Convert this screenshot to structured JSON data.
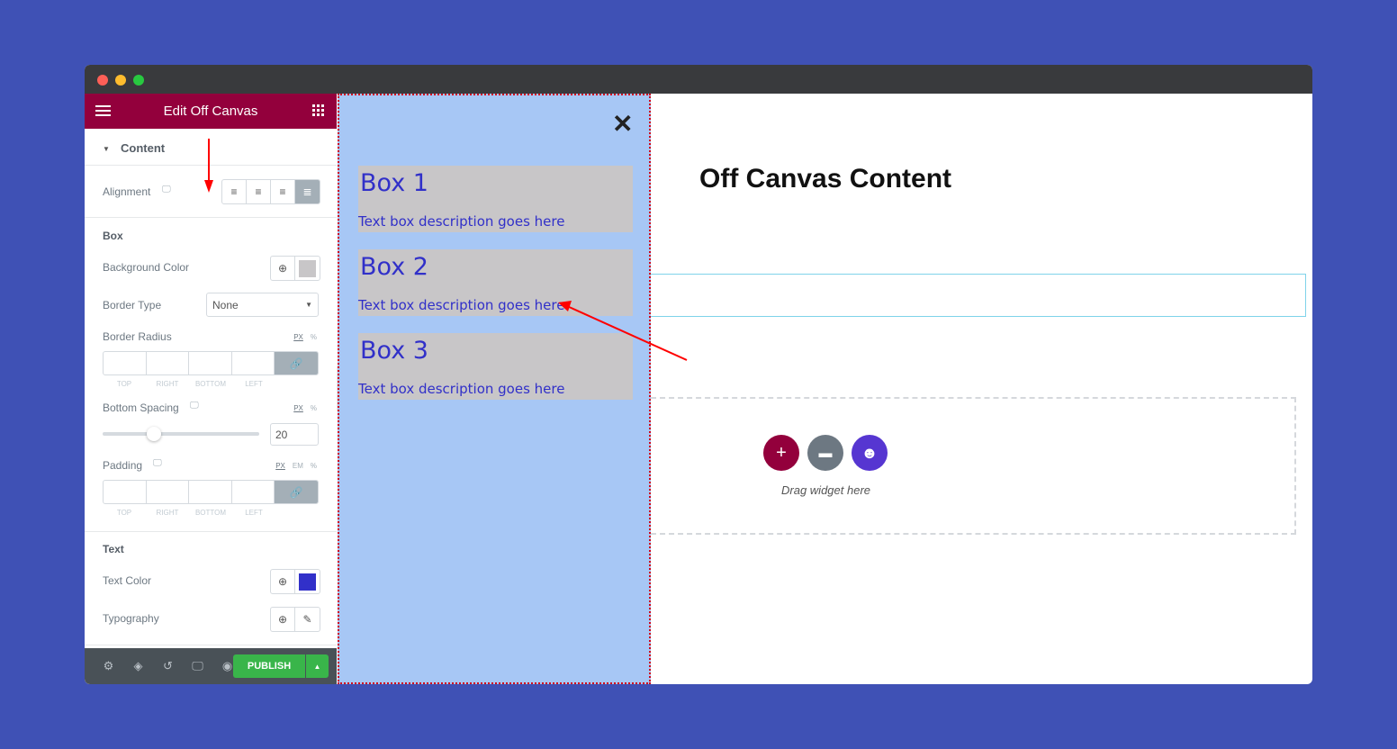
{
  "window": {
    "controls": [
      "close",
      "minimize",
      "maximize"
    ]
  },
  "panel": {
    "title": "Edit Off Canvas",
    "menu_icon": "hamburger-icon",
    "apps_icon": "grid-icon",
    "content_section": "Content",
    "alignment_label": "Alignment",
    "alignment_options": [
      "left",
      "center",
      "right",
      "justify"
    ],
    "alignment_selected": "justify",
    "box_section": "Box",
    "background_color_label": "Background Color",
    "background_color": "#c8c6c8",
    "border_type_label": "Border Type",
    "border_type_value": "None",
    "border_radius_label": "Border Radius",
    "units_px": "PX",
    "units_pct": "%",
    "units_em": "EM",
    "dim_labels": [
      "TOP",
      "RIGHT",
      "BOTTOM",
      "LEFT"
    ],
    "bottom_spacing_label": "Bottom Spacing",
    "bottom_spacing_value": "20",
    "padding_label": "Padding",
    "text_section": "Text",
    "text_color_label": "Text Color",
    "text_color": "#3130c9",
    "typography_label": "Typography",
    "publish_label": "PUBLISH"
  },
  "offcanvas": {
    "close_icon": "close-icon",
    "boxes": [
      {
        "title": "Box 1",
        "desc": "Text box description goes here"
      },
      {
        "title": "Box 2",
        "desc": "Text box description goes here"
      },
      {
        "title": "Box 3",
        "desc": "Text box description goes here"
      }
    ]
  },
  "canvas": {
    "title": "Off Canvas Content",
    "drop_text": "Drag widget here"
  },
  "colors": {
    "brand": "#93003c",
    "background": "#3f51b5",
    "publish": "#39b54a",
    "offcanvas_bg": "#a7c7f5"
  }
}
